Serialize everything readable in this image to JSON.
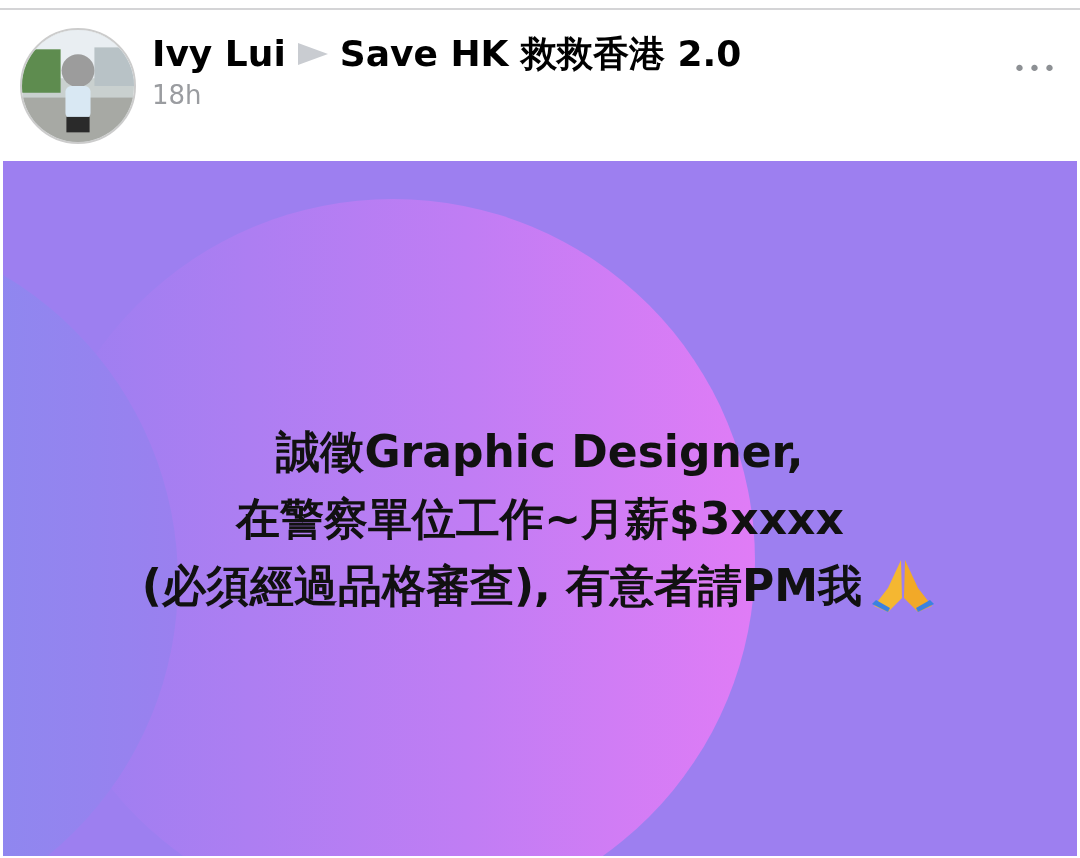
{
  "post": {
    "author": "Ivy Lui",
    "group": "Save HK 救救香港 2.0",
    "time": "18h",
    "more": "•••",
    "body_lines": [
      "誠徵Graphic Designer,",
      "在警察單位工作~月薪$3xxxx",
      "(必須經過品格審查), 有意者請PM我"
    ]
  }
}
